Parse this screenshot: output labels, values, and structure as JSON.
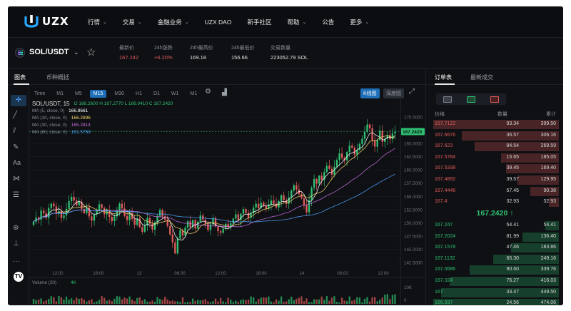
{
  "brand": {
    "logo_text": "UZX"
  },
  "nav": [
    {
      "label": "行情",
      "has_dropdown": true
    },
    {
      "label": "交易",
      "has_dropdown": true
    },
    {
      "label": "金融业务",
      "has_dropdown": true
    },
    {
      "label": "UZX DAO",
      "has_dropdown": false
    },
    {
      "label": "新手社区",
      "has_dropdown": false
    },
    {
      "label": "帮助",
      "has_dropdown": true
    },
    {
      "label": "公告",
      "has_dropdown": false
    },
    {
      "label": "更多",
      "has_dropdown": true
    }
  ],
  "ticker": {
    "symbol": "SOL/USDT",
    "stats": [
      {
        "label": "最新价",
        "value": "167.242",
        "tone": "red"
      },
      {
        "label": "24h涨跌",
        "value": "+6.20%",
        "tone": "red"
      },
      {
        "label": "24h最高价",
        "value": "169.18",
        "tone": "neutral"
      },
      {
        "label": "24h最低价",
        "value": "156.66",
        "tone": "neutral"
      },
      {
        "label": "交易数量",
        "value": "223052.79 SOL",
        "tone": "neutral"
      }
    ]
  },
  "chart_panel": {
    "tabs": [
      "图表",
      "币种概括"
    ],
    "active_tab": "图表",
    "timeframes": [
      "Time",
      "M1",
      "M5",
      "M15",
      "M30",
      "H1",
      "D1",
      "W1",
      "M1"
    ],
    "active_timeframe": "M15",
    "view_buttons": {
      "kline": "K线图",
      "depth": "深度图"
    },
    "active_view": "K线图"
  },
  "chart_data": {
    "type": "candlestick",
    "title": "SOL/USDT, 15",
    "ohlc_label": "O 166.2600  H 167.2770  L 166.0410  C 167.2420",
    "last_price": "167.2420",
    "indicators": [
      {
        "name": "MA (5, close, 0)",
        "value": "166.8661",
        "color": "#ffffff"
      },
      {
        "name": "MA (10, close, 0)",
        "value": "166.2896",
        "color": "#f5d76e"
      },
      {
        "name": "MA (30, close, 0)",
        "value": "165.2814",
        "color": "#c86ee0"
      },
      {
        "name": "MA (60, close, 0)",
        "value": "161.5769",
        "color": "#4ea3ff"
      }
    ],
    "y_ticks": [
      "170.0000",
      "167.5000",
      "165.0000",
      "162.5000",
      "160.0000",
      "157.5000",
      "155.0000",
      "152.5000",
      "150.0000",
      "147.5000",
      "145.0000",
      "142.5000"
    ],
    "ylim": [
      141.0,
      171.5
    ],
    "x_ticks": [
      "12:00",
      "18:00",
      "13",
      "06:00",
      "12:00",
      "18:00",
      "14",
      "06:00",
      "12:00"
    ],
    "close_series": [
      150.2,
      151.0,
      150.6,
      152.3,
      151.8,
      150.9,
      152.8,
      153.6,
      153.1,
      151.7,
      152.2,
      150.9,
      151.4,
      152.6,
      154.1,
      154.9,
      154.2,
      153.3,
      154.0,
      152.6,
      151.8,
      152.9,
      151.2,
      150.4,
      151.6,
      152.3,
      153.5,
      152.8,
      151.6,
      152.2,
      151.1,
      150.3,
      151.2,
      152.4,
      153.6,
      152.7,
      151.3,
      150.5,
      151.9,
      150.7,
      149.6,
      150.8,
      149.2,
      148.3,
      149.5,
      150.9,
      149.8,
      148.7,
      150.1,
      151.3,
      152.4,
      151.2,
      150.6,
      149.4,
      147.8,
      146.3,
      144.2,
      147.0,
      148.6,
      147.6,
      149.1,
      150.3,
      149.2,
      150.5,
      148.9,
      150.2,
      151.4,
      150.6,
      149.8,
      148.6,
      149.7,
      150.9,
      149.3,
      148.4,
      148.1,
      148.9,
      149.8,
      149.1,
      149.9,
      150.8,
      151.6,
      150.5,
      151.7,
      152.6,
      151.9,
      151.0,
      151.8,
      152.9,
      153.6,
      152.8,
      153.8,
      153.2,
      152.7,
      153.5,
      154.2,
      153.6,
      152.9,
      154.1,
      155.2,
      154.3,
      153.6,
      154.8,
      156.1,
      157.1,
      156.3,
      155.4,
      154.6,
      153.3,
      152.0,
      154.3,
      156.6,
      158.3,
      157.4,
      158.9,
      158.1,
      159.6,
      160.8,
      160.2,
      159.1,
      160.6,
      161.9,
      163.1,
      162.3,
      161.8,
      163.4,
      164.6,
      164.2,
      162.9,
      163.8,
      164.9,
      165.9,
      167.2,
      168.6,
      167.9,
      165.6,
      164.4,
      165.7,
      167.4,
      165.3,
      165.9,
      166.6,
      165.8,
      166.9,
      167.24
    ],
    "volume_label": "Volume (20)",
    "volume_value": "4K",
    "volume_ticks": [
      "10K",
      "0"
    ]
  },
  "order_book": {
    "tabs": [
      "订单表",
      "最新成交"
    ],
    "active_tab": "订单表",
    "columns": {
      "price": "价格",
      "amount": "数量",
      "total": "累计"
    },
    "asks": [
      {
        "price": "167.7122",
        "amount": "93.34",
        "total": "399.50",
        "depth": 1.0
      },
      {
        "price": "167.6676",
        "amount": "36.57",
        "total": "306.16",
        "depth": 0.77
      },
      {
        "price": "167.623",
        "amount": "84.54",
        "total": "269.59",
        "depth": 0.67
      },
      {
        "price": "167.5784",
        "amount": "15.65",
        "total": "185.05",
        "depth": 0.46
      },
      {
        "price": "167.5338",
        "amount": "39.45",
        "total": "169.40",
        "depth": 0.42
      },
      {
        "price": "167.4892",
        "amount": "39.57",
        "total": "129.95",
        "depth": 0.33
      },
      {
        "price": "167.4446",
        "amount": "57.45",
        "total": "90.38",
        "depth": 0.23
      },
      {
        "price": "167.4",
        "amount": "32.93",
        "total": "32.93",
        "depth": 0.08
      }
    ],
    "mid_price": "167.2420 ↑",
    "bids": [
      {
        "price": "167.247",
        "amount": "54.41",
        "total": "54.41",
        "depth": 0.11
      },
      {
        "price": "167.2024",
        "amount": "81.99",
        "total": "136.40",
        "depth": 0.29
      },
      {
        "price": "167.1578",
        "amount": "47.46",
        "total": "183.86",
        "depth": 0.38
      },
      {
        "price": "167.1132",
        "amount": "65.30",
        "total": "249.16",
        "depth": 0.52
      },
      {
        "price": "167.0686",
        "amount": "90.60",
        "total": "339.76",
        "depth": 0.71
      },
      {
        "price": "167.024",
        "amount": "76.27",
        "total": "416.03",
        "depth": 0.87
      },
      {
        "price": "167",
        "amount": "33.47",
        "total": "449.50",
        "depth": 0.94
      },
      {
        "price": "166.937",
        "amount": "24.56",
        "total": "474.06",
        "depth": 1.0
      }
    ]
  },
  "colors": {
    "up": "#2fbf71",
    "down": "#e05a5a",
    "accent": "#1e6fb8",
    "background": "#0e1013"
  }
}
